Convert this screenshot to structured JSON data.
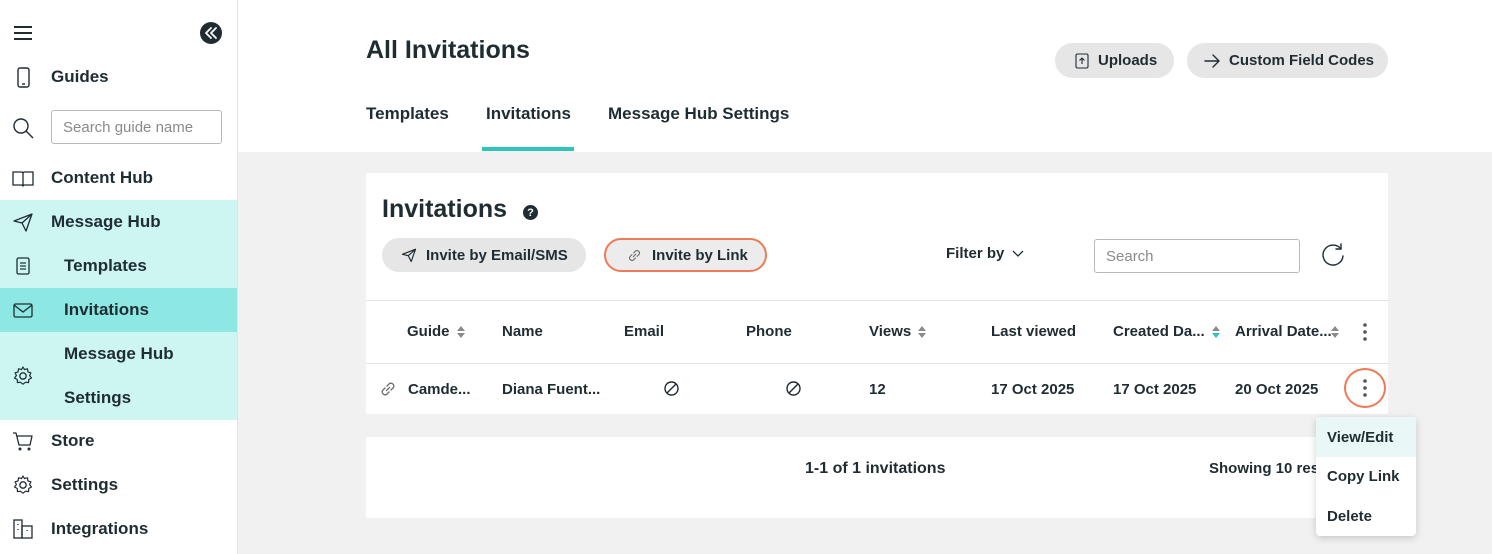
{
  "sidebar": {
    "guides_label": "Guides",
    "search_placeholder": "Search guide name",
    "content_hub_label": "Content Hub",
    "message_hub_label": "Message Hub",
    "templates_label": "Templates",
    "invitations_label": "Invitations",
    "mh_settings_line1": "Message Hub",
    "mh_settings_line2": "Settings",
    "store_label": "Store",
    "settings_label": "Settings",
    "integrations_label": "Integrations"
  },
  "header": {
    "title": "All Invitations",
    "uploads_label": "Uploads",
    "custom_field_codes_label": "Custom Field Codes"
  },
  "tabs": [
    {
      "label": "Templates"
    },
    {
      "label": "Invitations",
      "active": true
    },
    {
      "label": "Message Hub Settings"
    }
  ],
  "invitations": {
    "title": "Invitations",
    "help_glyph": "?",
    "invite_email_label": "Invite by Email/SMS",
    "invite_link_label": "Invite by Link",
    "filter_label": "Filter by",
    "search_placeholder": "Search",
    "columns": {
      "guide": "Guide",
      "name": "Name",
      "email": "Email",
      "phone": "Phone",
      "views": "Views",
      "last_viewed": "Last viewed",
      "created_date": "Created Da...",
      "arrival_date": "Arrival Date..."
    },
    "rows": [
      {
        "guide": "Camde...",
        "name": "Diana Fuent...",
        "views": "12",
        "last_viewed": "17 Oct 2025",
        "created_date": "17 Oct 2025",
        "arrival_date": "20 Oct 2025"
      }
    ],
    "count_text": "1-1 of 1 invitations",
    "showing_text": "Showing 10 results"
  },
  "row_menu": {
    "items": [
      "View/Edit",
      "Copy Link",
      "Delete"
    ]
  },
  "colors": {
    "accent": "#2ec4bc",
    "nav_highlight": "#8de8e3",
    "nav_group_bg": "#cdf6f2",
    "focus_ring": "#ee7b55",
    "text": "#1f2d33"
  }
}
